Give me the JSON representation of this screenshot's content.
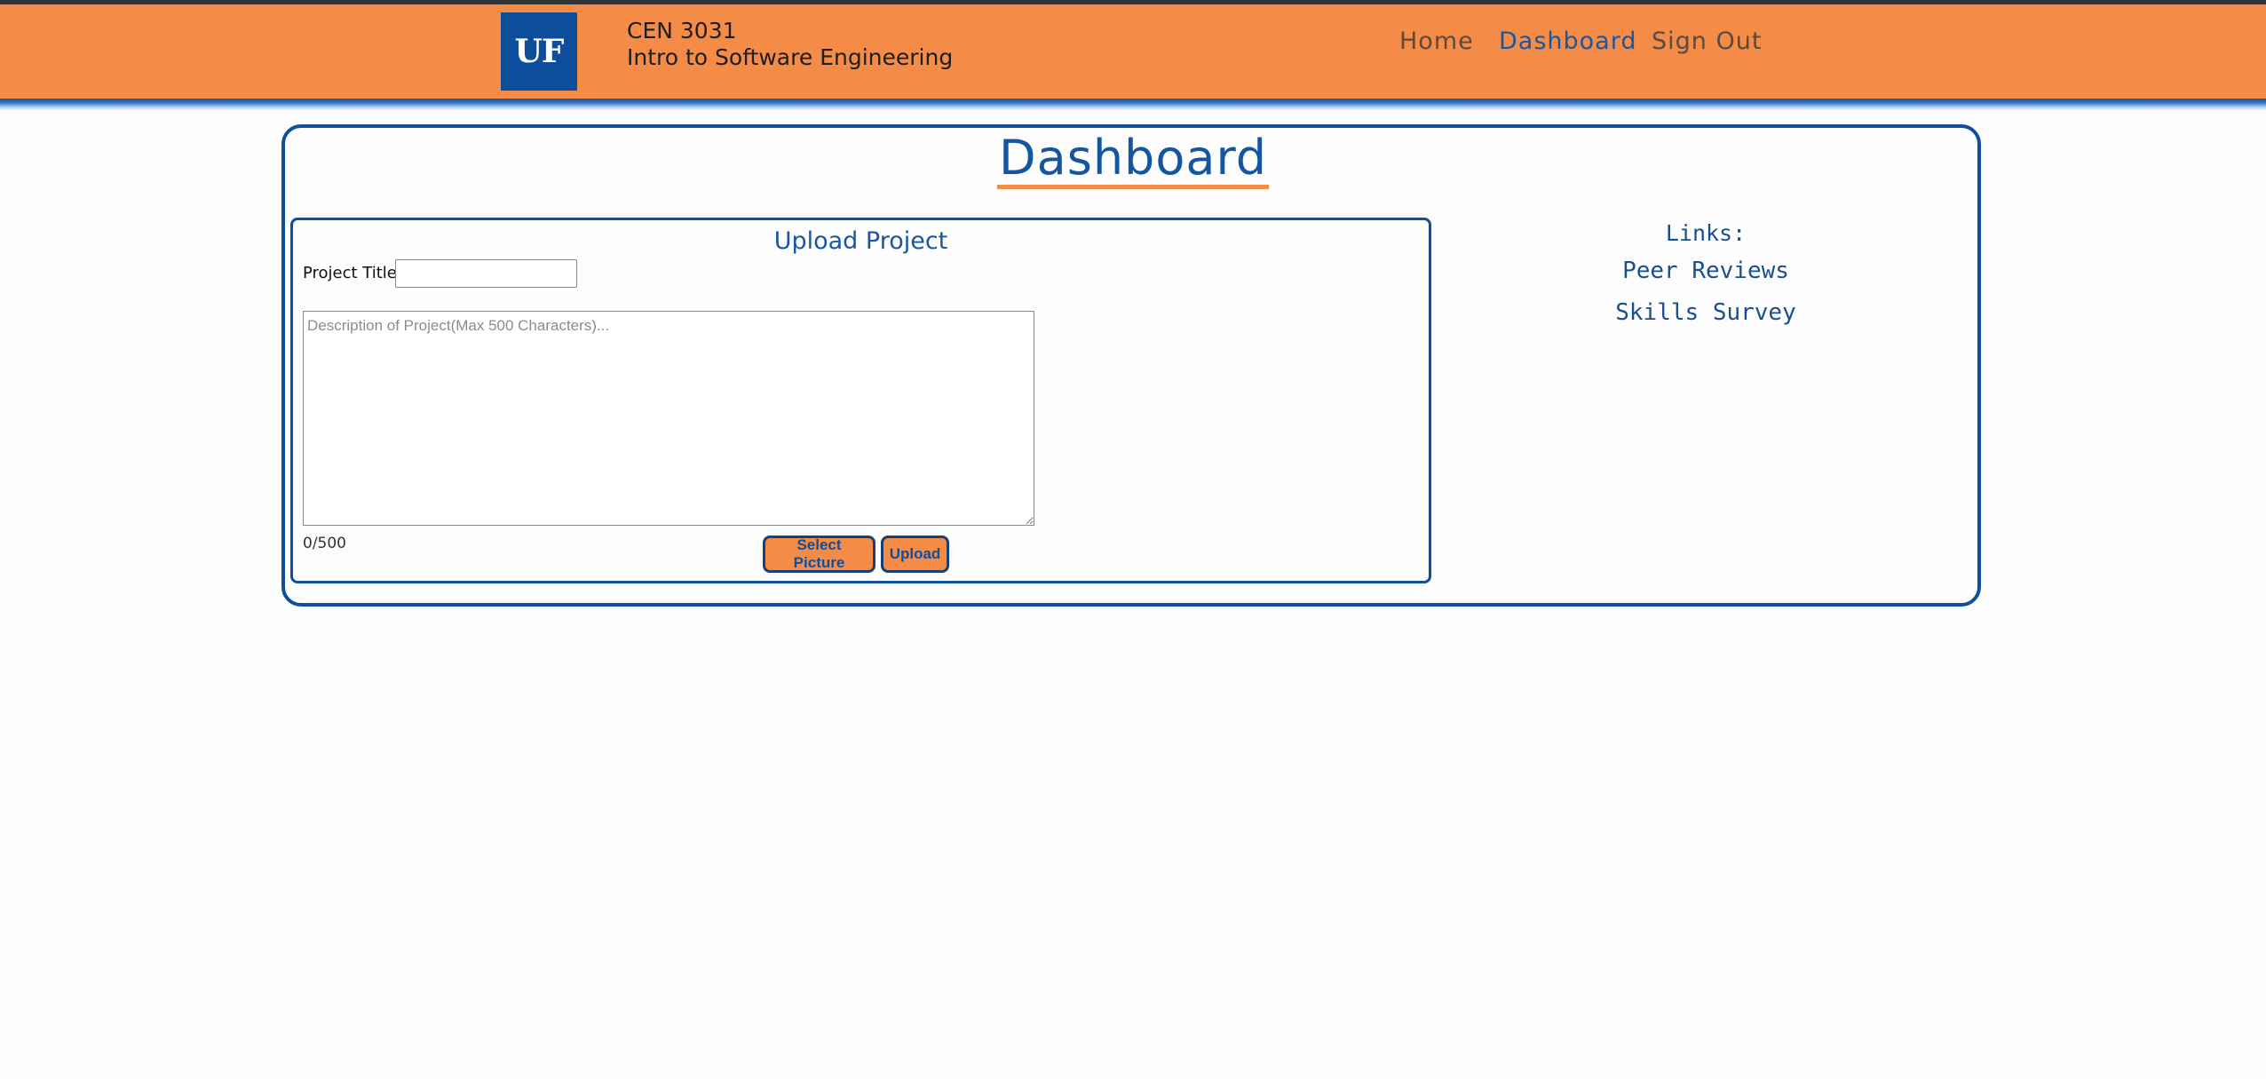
{
  "header": {
    "logo_text": "UF",
    "course_code": "CEN 3031",
    "course_name": "Intro to Software Engineering",
    "nav": [
      {
        "label": "Home"
      },
      {
        "label": "Dashboard",
        "active": true
      },
      {
        "label": "Sign Out"
      }
    ]
  },
  "main": {
    "title": "Dashboard",
    "upload": {
      "heading": "Upload Project",
      "title_label": "Project Title:",
      "title_value": "",
      "description_placeholder": "Description of Project(Max 500 Characters)...",
      "description_value": "",
      "char_count": "0/500",
      "select_picture_label": "Select Picture",
      "upload_label": "Upload"
    },
    "links": {
      "heading": "Links:",
      "items": [
        {
          "label": "Peer Reviews"
        },
        {
          "label": "Skills Survey"
        }
      ]
    }
  },
  "colors": {
    "brand_orange": "#f48b46",
    "brand_blue": "#0f4f9c"
  }
}
